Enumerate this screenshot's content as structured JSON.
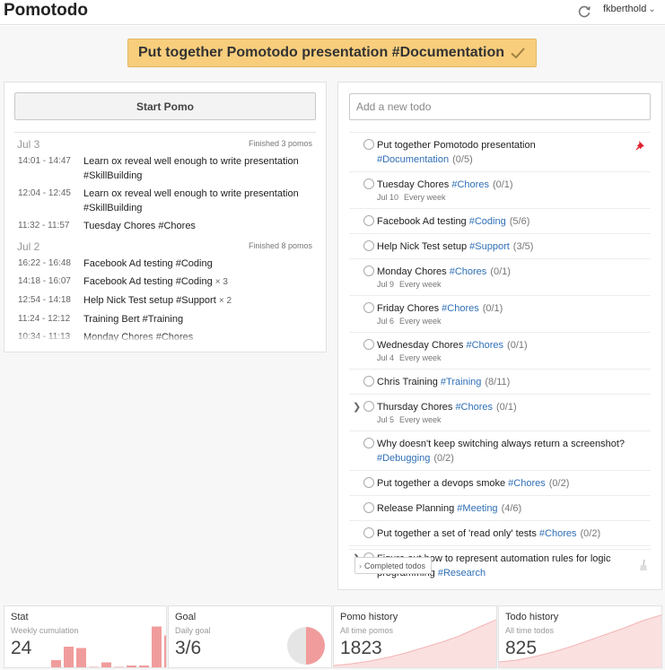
{
  "header": {
    "logo": "Pomotodo",
    "sync_icon": "refresh-icon",
    "username": "fkberthold"
  },
  "banner": {
    "task": "Put together Pomotodo presentation #Documentation",
    "icon": "check-icon",
    "color": "#f8ce7d"
  },
  "pomo": {
    "start_label": "Start Pomo",
    "days": [
      {
        "date": "Jul 3",
        "summary": "Finished 3 pomos",
        "entries": [
          {
            "time": "14:01 - 14:47",
            "text": "Learn ox reveal well enough to write presentation #SkillBuilding",
            "mult": ""
          },
          {
            "time": "12:04 - 12:45",
            "text": "Learn ox reveal well enough to write presentation #SkillBuilding",
            "mult": ""
          },
          {
            "time": "11:32 - 11:57",
            "text": "Tuesday Chores #Chores",
            "mult": ""
          }
        ]
      },
      {
        "date": "Jul 2",
        "summary": "Finished 8 pomos",
        "entries": [
          {
            "time": "16:22 - 16:48",
            "text": "Facebook Ad testing #Coding",
            "mult": ""
          },
          {
            "time": "14:18 - 16:07",
            "text": "Facebook Ad testing #Coding",
            "mult": "× 3"
          },
          {
            "time": "12:54 - 14:18",
            "text": "Help Nick Test setup #Support",
            "mult": "× 2"
          },
          {
            "time": "11:24 - 12:12",
            "text": "Training Bert #Training",
            "mult": ""
          },
          {
            "time": "10:34 - 11:13",
            "text": "Monday Chores #Chores",
            "mult": ""
          }
        ]
      }
    ]
  },
  "todos": {
    "add_placeholder": "Add a new todo",
    "tag_color": "#2f6fb6",
    "items": [
      {
        "title": "Put together Pomotodo presentation",
        "tag": "#Documentation",
        "count": "(0/5)",
        "date": "",
        "repeat": "",
        "pinned": true,
        "expandable": false
      },
      {
        "title": "Tuesday Chores",
        "tag": "#Chores",
        "count": "(0/1)",
        "date": "Jul 10",
        "repeat": "Every week",
        "pinned": false,
        "expandable": false
      },
      {
        "title": "Facebook Ad testing",
        "tag": "#Coding",
        "count": "(5/6)",
        "date": "",
        "repeat": "",
        "pinned": false,
        "expandable": false
      },
      {
        "title": "Help Nick Test setup",
        "tag": "#Support",
        "count": "(3/5)",
        "date": "",
        "repeat": "",
        "pinned": false,
        "expandable": false
      },
      {
        "title": "Monday Chores",
        "tag": "#Chores",
        "count": "(0/1)",
        "date": "Jul 9",
        "repeat": "Every week",
        "pinned": false,
        "expandable": false
      },
      {
        "title": "Friday Chores",
        "tag": "#Chores",
        "count": "(0/1)",
        "date": "Jul 6",
        "repeat": "Every week",
        "pinned": false,
        "expandable": false
      },
      {
        "title": "Wednesday Chores",
        "tag": "#Chores",
        "count": "(0/1)",
        "date": "Jul 4",
        "repeat": "Every week",
        "pinned": false,
        "expandable": false
      },
      {
        "title": "Chris Training",
        "tag": "#Training",
        "count": "(8/11)",
        "date": "",
        "repeat": "",
        "pinned": false,
        "expandable": false
      },
      {
        "title": "Thursday Chores",
        "tag": "#Chores",
        "count": "(0/1)",
        "date": "Jul 5",
        "repeat": "Every week",
        "pinned": false,
        "expandable": true
      },
      {
        "title": "Why doesn't keep switching always return a screenshot?",
        "tag": "#Debugging",
        "count": "(0/2)",
        "date": "",
        "repeat": "",
        "pinned": false,
        "expandable": false
      },
      {
        "title": "Put together a devops smoke",
        "tag": "#Chores",
        "count": "(0/2)",
        "date": "",
        "repeat": "",
        "pinned": false,
        "expandable": false
      },
      {
        "title": "Release Planning",
        "tag": "#Meeting",
        "count": "(4/6)",
        "date": "",
        "repeat": "",
        "pinned": false,
        "expandable": false
      },
      {
        "title": "Put together a set of 'read only' tests",
        "tag": "#Chores",
        "count": "(0/2)",
        "date": "",
        "repeat": "",
        "pinned": false,
        "expandable": false
      },
      {
        "title": "Figure out how to represent automation rules for logic programming",
        "tag": "#Research",
        "count": "",
        "date": "",
        "repeat": "",
        "pinned": false,
        "expandable": true
      }
    ],
    "completed_label": "Completed todos",
    "clear_icon": "broom-icon"
  },
  "stats": {
    "stat": {
      "title": "Stat",
      "sub": "Weekly cumulation",
      "value": "24",
      "bar_levels": [
        0.2,
        0.5,
        0.47,
        0.05,
        0.15,
        0.05,
        0.08,
        0.08,
        0.95,
        0.75
      ]
    },
    "goal": {
      "title": "Goal",
      "sub": "Daily goal",
      "value": "3/6",
      "progress": 0.5
    },
    "pomo_history": {
      "title": "Pomo history",
      "sub": "All time pomos",
      "value": "1823"
    },
    "todo_history": {
      "title": "Todo history",
      "sub": "All time todos",
      "value": "825"
    },
    "chart_color": "#f19c9c"
  }
}
